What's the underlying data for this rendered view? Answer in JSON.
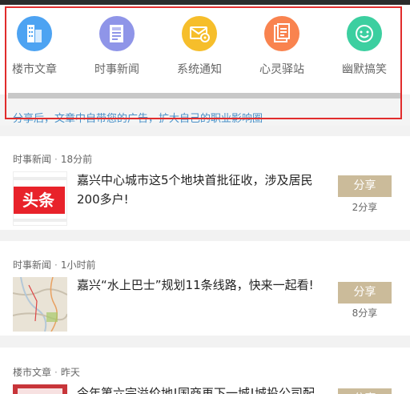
{
  "categories": [
    {
      "label": "楼市文章",
      "icon": "building-icon",
      "color": "#4da3f2"
    },
    {
      "label": "时事新闻",
      "icon": "newspaper-icon",
      "color": "#8f95e8"
    },
    {
      "label": "系统通知",
      "icon": "mail-gear-icon",
      "color": "#f6be2b"
    },
    {
      "label": "心灵驿站",
      "icon": "document-icon",
      "color": "#f9834f"
    },
    {
      "label": "幽默搞笑",
      "icon": "smiley-icon",
      "color": "#3ccfa0"
    }
  ],
  "banner_text": "分享后，文章中自带您的广告，扩大自己的职业影响圈",
  "articles": [
    {
      "category": "时事新闻",
      "time": "18分前",
      "thumb_text": "头条",
      "title": "嘉兴中心城市这5个地块首批征收，涉及居民200多户!",
      "share_label": "分享",
      "share_count": "2分享"
    },
    {
      "category": "时事新闻",
      "time": "1小时前",
      "title": "嘉兴“水上巴士”规划11条线路，快来一起看!",
      "share_label": "分享",
      "share_count": "8分享"
    },
    {
      "category": "楼市文章",
      "time": "昨天",
      "title": "今年第六宗溢价地!国商再下一城!城投公司配",
      "share_label": "分享"
    }
  ],
  "colors": {
    "highlight_border": "#e12c2c",
    "share_button": "#cbbb9a",
    "banner_text": "#4a90c8",
    "thumb_red": "#e8222a"
  }
}
